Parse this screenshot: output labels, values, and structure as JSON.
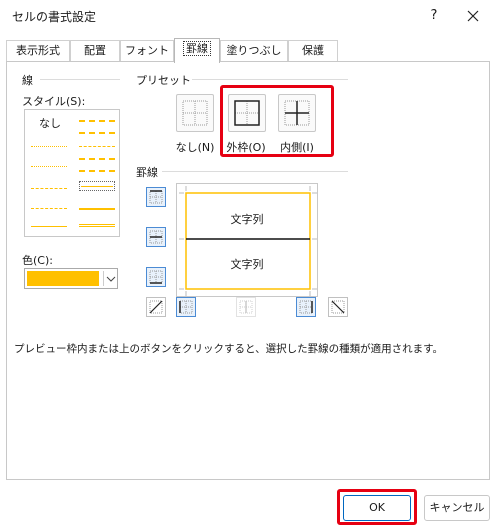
{
  "window": {
    "title": "セルの書式設定",
    "help": "?",
    "close_icon": "close-icon"
  },
  "tabs": [
    {
      "label": "表示形式",
      "active": false
    },
    {
      "label": "配置",
      "active": false
    },
    {
      "label": "フォント",
      "active": false
    },
    {
      "label": "罫線",
      "active": true
    },
    {
      "label": "塗りつぶし",
      "active": false
    },
    {
      "label": "保護",
      "active": false
    }
  ],
  "line": {
    "group_label": "線",
    "style_label": "スタイル(S):",
    "none_label": "なし",
    "color_label": "色(C):",
    "color_value": "#ffc000"
  },
  "presets": {
    "group_label": "プリセット",
    "items": [
      {
        "label": "なし(N)",
        "icon": "border-none-icon"
      },
      {
        "label": "外枠(O)",
        "icon": "border-outline-icon"
      },
      {
        "label": "内側(I)",
        "icon": "border-inside-icon"
      }
    ]
  },
  "border": {
    "group_label": "罫線",
    "preview_text_top": "文字列",
    "preview_text_bottom": "文字列"
  },
  "description": "プレビュー枠内または上のボタンをクリックすると、選択した罫線の種類が適用されます。",
  "footer": {
    "ok": "OK",
    "cancel": "キャンセル"
  },
  "colors": {
    "accent": "#0067c0",
    "highlight": "#e60012",
    "line_color": "#ffc000"
  }
}
